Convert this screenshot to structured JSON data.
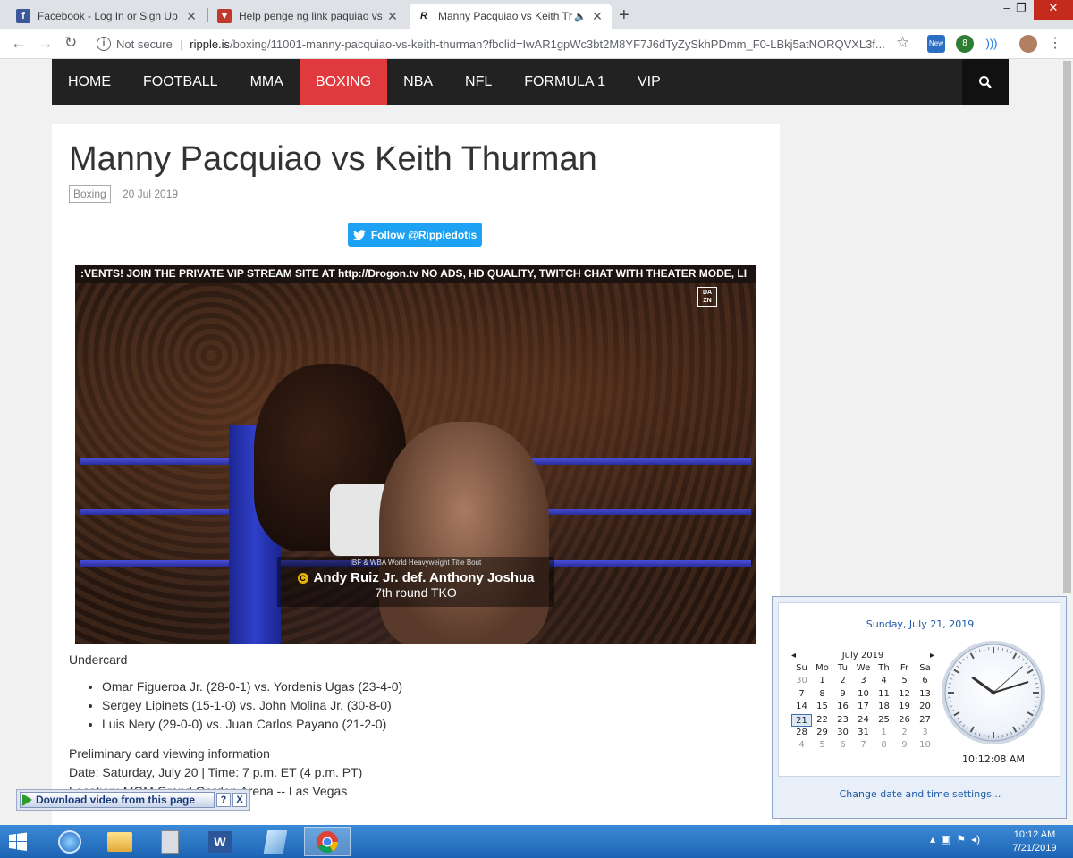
{
  "browser": {
    "tabs": [
      {
        "title": "Facebook - Log In or Sign Up",
        "icon": "facebook-icon"
      },
      {
        "title": "Help penge ng link paquiao vs th",
        "icon": "shield-icon"
      },
      {
        "title": "Manny Pacquiao vs Keith Thu",
        "icon": "ripple-icon",
        "active": true,
        "audio": "speaker-icon"
      }
    ],
    "window_controls": {
      "minimize": "–",
      "restore": "❐",
      "close": "✕"
    },
    "security_label": "Not secure",
    "url_host": "ripple.is",
    "url_path": "/boxing/11001-manny-pacquiao-vs-keith-thurman?fbclid=IwAR1gpWc3bt2M8YF7J6dTyZySkhPDmm_F0-LBkj5atNORQVXL3f...",
    "extensions": [
      {
        "icon": "new-badge-icon",
        "label": "New"
      },
      {
        "icon": "extension-badge-icon",
        "label": "8"
      },
      {
        "icon": "cast-icon",
        "label": ""
      },
      {
        "icon": "avatar",
        "label": ""
      }
    ]
  },
  "site_nav": {
    "items": [
      "HOME",
      "FOOTBALL",
      "MMA",
      "BOXING",
      "NBA",
      "NFL",
      "FORMULA 1",
      "VIP"
    ],
    "active": "BOXING"
  },
  "article": {
    "title": "Manny Pacquiao vs Keith Thurman",
    "category": "Boxing",
    "date": "20 Jul 2019",
    "follow_label": "Follow @Rippledotis",
    "video": {
      "ticker": ":VENTS! JOIN THE PRIVATE VIP STREAM SITE AT http://Drogon.tv NO ADS, HD QUALITY, TWITCH CHAT WITH THEATER MODE, LI",
      "dazn_logo": "DA ZN",
      "lower_third_top": "IBF & WBA World Heavyweight Title Bout",
      "lower_third_main": "Andy Ruiz Jr. def. Anthony Joshua",
      "lower_third_sub": "7th round TKO"
    },
    "undercard_heading": "Undercard",
    "undercard": [
      "Omar Figueroa Jr. (28-0-1) vs. Yordenis Ugas (23-4-0)",
      "Sergey Lipinets (15-1-0) vs. John Molina Jr. (30-8-0)",
      "Luis Nery (29-0-0) vs. Juan Carlos Payano (21-2-0)"
    ],
    "prelim_heading": "Preliminary card viewing information",
    "prelim_date": "Date: Saturday, July 20 | Time: 7 p.m. ET (4 p.m. PT)",
    "prelim_location": "Location: MGM Grand Garden Arena -- Las Vegas"
  },
  "download_bar": {
    "label": "Download video from this page",
    "help": "?",
    "close": "X"
  },
  "clock_popup": {
    "long_date": "Sunday, July 21, 2019",
    "month_label": "July 2019",
    "weekdays": [
      "Su",
      "Mo",
      "Tu",
      "We",
      "Th",
      "Fr",
      "Sa"
    ],
    "days": [
      [
        "30",
        "1",
        "2",
        "3",
        "4",
        "5",
        "6"
      ],
      [
        "7",
        "8",
        "9",
        "10",
        "11",
        "12",
        "13"
      ],
      [
        "14",
        "15",
        "16",
        "17",
        "18",
        "19",
        "20"
      ],
      [
        "21",
        "22",
        "23",
        "24",
        "25",
        "26",
        "27"
      ],
      [
        "28",
        "29",
        "30",
        "31",
        "1",
        "2",
        "3"
      ],
      [
        "4",
        "5",
        "6",
        "7",
        "8",
        "9",
        "10"
      ]
    ],
    "today": "21",
    "time_text": "10:12:08 AM",
    "analog_time": {
      "hours": 10,
      "minutes": 12,
      "seconds": 8
    },
    "change_link": "Change date and time settings..."
  },
  "taskbar": {
    "items": [
      "windows-start-icon",
      "ie-icon",
      "folder-icon",
      "calculator-icon",
      "word-icon",
      "notepad-icon",
      "chrome-icon"
    ],
    "time": "10:12 AM",
    "date": "7/21/2019"
  },
  "colors": {
    "nav_bg": "#222222",
    "nav_active": "#e03a3e",
    "twitter": "#1da1f2",
    "link_blue": "#1e5aa8"
  }
}
